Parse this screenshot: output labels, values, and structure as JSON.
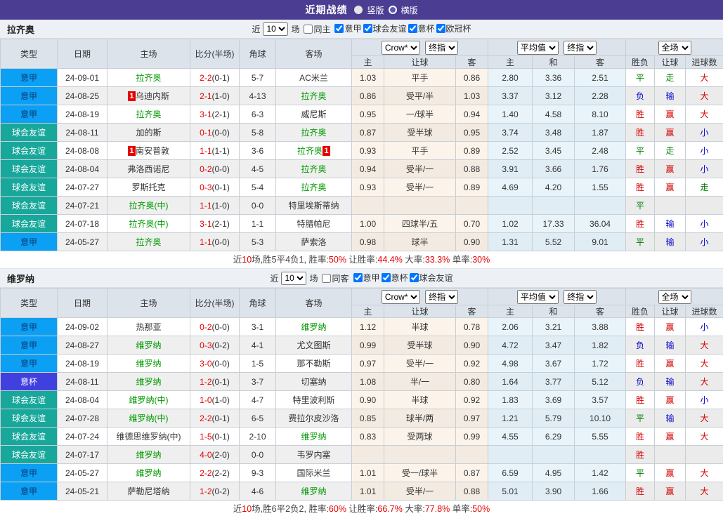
{
  "title_bar": {
    "title": "近期战绩",
    "radios": [
      {
        "label": "竖版",
        "selected": true
      },
      {
        "label": "横版",
        "selected": false
      }
    ]
  },
  "filter_labels": {
    "near": "近",
    "games": "场"
  },
  "table_header": {
    "type": "类型",
    "date": "日期",
    "home": "主场",
    "score": "比分(半场)",
    "corners": "角球",
    "away": "客场",
    "selects": {
      "book": "Crow*",
      "final_a": "终指",
      "avg": "平均值",
      "final_b": "终指",
      "scope": "全场"
    },
    "sub": [
      "主",
      "让球",
      "客",
      "主",
      "和",
      "客",
      "胜负",
      "让球",
      "进球数"
    ]
  },
  "colors": {
    "titlebar_purple": "#4B3D92",
    "seriea_blue": "#0BA0F3",
    "friendly_teal": "#18A79B",
    "cup_indigo": "#4040DF",
    "focus_team_green": "#009900",
    "score_red": "#E60000",
    "win_red": "#D40000",
    "draw_green": "#008000",
    "lose_blue": "#0000CC"
  },
  "sections": [
    {
      "team": "拉齐奥",
      "filter": {
        "count": "10",
        "same_label": "同主",
        "same_checked": false,
        "leagues": [
          {
            "label": "意甲",
            "checked": true
          },
          {
            "label": "球会友谊",
            "checked": true
          },
          {
            "label": "意杯",
            "checked": true
          },
          {
            "label": "欧冠杯",
            "checked": true
          }
        ]
      },
      "rows": [
        {
          "league": "意甲",
          "date": "24-09-01",
          "home": {
            "name": "拉齐奥",
            "focus": true
          },
          "score": {
            "full": "2-2",
            "half": "(0-1)"
          },
          "corners": "5-7",
          "away": {
            "name": "AC米兰"
          },
          "odds": [
            "1.03",
            "平手",
            "0.86"
          ],
          "avg": [
            "2.80",
            "3.36",
            "2.51"
          ],
          "results": [
            "平",
            "走",
            "大"
          ]
        },
        {
          "league": "意甲",
          "date": "24-08-25",
          "home": {
            "name": "乌迪内斯",
            "badge": "1",
            "badge_pos": "before"
          },
          "score": {
            "full": "2-1",
            "half": "(1-0)"
          },
          "corners": "4-13",
          "away": {
            "name": "拉齐奥",
            "focus": true
          },
          "odds": [
            "0.86",
            "受平/半",
            "1.03"
          ],
          "avg": [
            "3.37",
            "3.12",
            "2.28"
          ],
          "results": [
            "负",
            "输",
            "大"
          ]
        },
        {
          "league": "意甲",
          "date": "24-08-19",
          "home": {
            "name": "拉齐奥",
            "focus": true
          },
          "score": {
            "full": "3-1",
            "half": "(2-1)"
          },
          "corners": "6-3",
          "away": {
            "name": "威尼斯"
          },
          "odds": [
            "0.95",
            "一/球半",
            "0.94"
          ],
          "avg": [
            "1.40",
            "4.58",
            "8.10"
          ],
          "results": [
            "胜",
            "赢",
            "大"
          ]
        },
        {
          "league": "球会友谊",
          "date": "24-08-11",
          "home": {
            "name": "加的斯"
          },
          "score": {
            "full": "0-1",
            "half": "(0-0)"
          },
          "corners": "5-8",
          "away": {
            "name": "拉齐奥",
            "focus": true
          },
          "odds": [
            "0.87",
            "受半球",
            "0.95"
          ],
          "avg": [
            "3.74",
            "3.48",
            "1.87"
          ],
          "results": [
            "胜",
            "赢",
            "小"
          ]
        },
        {
          "league": "球会友谊",
          "date": "24-08-08",
          "home": {
            "name": "南安普敦",
            "badge": "1",
            "badge_pos": "before"
          },
          "score": {
            "full": "1-1",
            "half": "(1-1)"
          },
          "corners": "3-6",
          "away": {
            "name": "拉齐奥",
            "focus": true,
            "badge": "1",
            "badge_pos": "after"
          },
          "odds": [
            "0.93",
            "平手",
            "0.89"
          ],
          "avg": [
            "2.52",
            "3.45",
            "2.48"
          ],
          "results": [
            "平",
            "走",
            "小"
          ]
        },
        {
          "league": "球会友谊",
          "date": "24-08-04",
          "home": {
            "name": "弗洛西诺尼"
          },
          "score": {
            "full": "0-2",
            "half": "(0-0)"
          },
          "corners": "4-5",
          "away": {
            "name": "拉齐奥",
            "focus": true
          },
          "odds": [
            "0.94",
            "受半/一",
            "0.88"
          ],
          "avg": [
            "3.91",
            "3.66",
            "1.76"
          ],
          "results": [
            "胜",
            "赢",
            "小"
          ]
        },
        {
          "league": "球会友谊",
          "date": "24-07-27",
          "home": {
            "name": "罗斯托克"
          },
          "score": {
            "full": "0-3",
            "half": "(0-1)"
          },
          "corners": "5-4",
          "away": {
            "name": "拉齐奥",
            "focus": true
          },
          "odds": [
            "0.93",
            "受半/一",
            "0.89"
          ],
          "avg": [
            "4.69",
            "4.20",
            "1.55"
          ],
          "results": [
            "胜",
            "赢",
            "走"
          ]
        },
        {
          "league": "球会友谊",
          "date": "24-07-21",
          "home": {
            "name": "拉齐奥(中)",
            "focus": true
          },
          "score": {
            "full": "1-1",
            "half": "(1-0)"
          },
          "corners": "0-0",
          "away": {
            "name": "特里埃斯蒂纳"
          },
          "odds": [
            "",
            "",
            ""
          ],
          "avg": [
            "",
            "",
            ""
          ],
          "results": [
            "平",
            "",
            ""
          ]
        },
        {
          "league": "球会友谊",
          "date": "24-07-18",
          "home": {
            "name": "拉齐奥(中)",
            "focus": true
          },
          "score": {
            "full": "3-1",
            "half": "(2-1)"
          },
          "corners": "1-1",
          "away": {
            "name": "特腊帕尼"
          },
          "odds": [
            "1.00",
            "四球半/五",
            "0.70"
          ],
          "avg": [
            "1.02",
            "17.33",
            "36.04"
          ],
          "results": [
            "胜",
            "输",
            "小"
          ]
        },
        {
          "league": "意甲",
          "date": "24-05-27",
          "home": {
            "name": "拉齐奥",
            "focus": true
          },
          "score": {
            "full": "1-1",
            "half": "(0-0)"
          },
          "corners": "5-3",
          "away": {
            "name": "萨索洛"
          },
          "odds": [
            "0.98",
            "球半",
            "0.90"
          ],
          "avg": [
            "1.31",
            "5.52",
            "9.01"
          ],
          "results": [
            "平",
            "输",
            "小"
          ]
        }
      ],
      "summary": [
        {
          "text": "近"
        },
        {
          "text": "10",
          "red": true
        },
        {
          "text": "场,胜5平4负1, 胜率:"
        },
        {
          "text": "50%",
          "red": true
        },
        {
          "text": " 让胜率:"
        },
        {
          "text": "44.4%",
          "red": true
        },
        {
          "text": " 大率:"
        },
        {
          "text": "33.3%",
          "red": true
        },
        {
          "text": " 单率:"
        },
        {
          "text": "30%",
          "red": true
        }
      ]
    },
    {
      "team": "维罗纳",
      "filter": {
        "count": "10",
        "same_label": "同客",
        "same_checked": false,
        "leagues": [
          {
            "label": "意甲",
            "checked": true
          },
          {
            "label": "意杯",
            "checked": true
          },
          {
            "label": "球会友谊",
            "checked": true
          }
        ]
      },
      "rows": [
        {
          "league": "意甲",
          "date": "24-09-02",
          "home": {
            "name": "热那亚"
          },
          "score": {
            "full": "0-2",
            "half": "(0-0)"
          },
          "corners": "3-1",
          "away": {
            "name": "维罗纳",
            "focus": true
          },
          "odds": [
            "1.12",
            "半球",
            "0.78"
          ],
          "avg": [
            "2.06",
            "3.21",
            "3.88"
          ],
          "results": [
            "胜",
            "赢",
            "小"
          ]
        },
        {
          "league": "意甲",
          "date": "24-08-27",
          "home": {
            "name": "维罗纳",
            "focus": true
          },
          "score": {
            "full": "0-3",
            "half": "(0-2)"
          },
          "corners": "4-1",
          "away": {
            "name": "尤文图斯"
          },
          "odds": [
            "0.99",
            "受半球",
            "0.90"
          ],
          "avg": [
            "4.72",
            "3.47",
            "1.82"
          ],
          "results": [
            "负",
            "输",
            "大"
          ]
        },
        {
          "league": "意甲",
          "date": "24-08-19",
          "home": {
            "name": "维罗纳",
            "focus": true
          },
          "score": {
            "full": "3-0",
            "half": "(0-0)"
          },
          "corners": "1-5",
          "away": {
            "name": "那不勒斯"
          },
          "odds": [
            "0.97",
            "受半/一",
            "0.92"
          ],
          "avg": [
            "4.98",
            "3.67",
            "1.72"
          ],
          "results": [
            "胜",
            "赢",
            "大"
          ]
        },
        {
          "league": "意杯",
          "date": "24-08-11",
          "home": {
            "name": "维罗纳",
            "focus": true
          },
          "score": {
            "full": "1-2",
            "half": "(0-1)"
          },
          "corners": "3-7",
          "away": {
            "name": "切塞纳"
          },
          "odds": [
            "1.08",
            "半/一",
            "0.80"
          ],
          "avg": [
            "1.64",
            "3.77",
            "5.12"
          ],
          "results": [
            "负",
            "输",
            "大"
          ]
        },
        {
          "league": "球会友谊",
          "date": "24-08-04",
          "home": {
            "name": "维罗纳(中)",
            "focus": true
          },
          "score": {
            "full": "1-0",
            "half": "(1-0)"
          },
          "corners": "4-7",
          "away": {
            "name": "特里波利斯"
          },
          "odds": [
            "0.90",
            "半球",
            "0.92"
          ],
          "avg": [
            "1.83",
            "3.69",
            "3.57"
          ],
          "results": [
            "胜",
            "赢",
            "小"
          ]
        },
        {
          "league": "球会友谊",
          "date": "24-07-28",
          "home": {
            "name": "维罗纳(中)",
            "focus": true
          },
          "score": {
            "full": "2-2",
            "half": "(0-1)"
          },
          "corners": "6-5",
          "away": {
            "name": "费拉尔皮沙洛"
          },
          "odds": [
            "0.85",
            "球半/两",
            "0.97"
          ],
          "avg": [
            "1.21",
            "5.79",
            "10.10"
          ],
          "results": [
            "平",
            "输",
            "大"
          ]
        },
        {
          "league": "球会友谊",
          "date": "24-07-24",
          "home": {
            "name": "维德思维罗纳(中)"
          },
          "score": {
            "full": "1-5",
            "half": "(0-1)"
          },
          "corners": "2-10",
          "away": {
            "name": "维罗纳",
            "focus": true
          },
          "odds": [
            "0.83",
            "受两球",
            "0.99"
          ],
          "avg": [
            "4.55",
            "6.29",
            "5.55"
          ],
          "results": [
            "胜",
            "赢",
            "大"
          ]
        },
        {
          "league": "球会友谊",
          "date": "24-07-17",
          "home": {
            "name": "维罗纳",
            "focus": true
          },
          "score": {
            "full": "4-0",
            "half": "(2-0)"
          },
          "corners": "0-0",
          "away": {
            "name": "韦罗内塞"
          },
          "odds": [
            "",
            "",
            ""
          ],
          "avg": [
            "",
            "",
            ""
          ],
          "results": [
            "胜",
            "",
            ""
          ]
        },
        {
          "league": "意甲",
          "date": "24-05-27",
          "home": {
            "name": "维罗纳",
            "focus": true
          },
          "score": {
            "full": "2-2",
            "half": "(2-2)"
          },
          "corners": "9-3",
          "away": {
            "name": "国际米兰"
          },
          "odds": [
            "1.01",
            "受一/球半",
            "0.87"
          ],
          "avg": [
            "6.59",
            "4.95",
            "1.42"
          ],
          "results": [
            "平",
            "赢",
            "大"
          ]
        },
        {
          "league": "意甲",
          "date": "24-05-21",
          "home": {
            "name": "萨勒尼塔纳"
          },
          "score": {
            "full": "1-2",
            "half": "(0-2)"
          },
          "corners": "4-6",
          "away": {
            "name": "维罗纳",
            "focus": true
          },
          "odds": [
            "1.01",
            "受半/一",
            "0.88"
          ],
          "avg": [
            "5.01",
            "3.90",
            "1.66"
          ],
          "results": [
            "胜",
            "赢",
            "大"
          ]
        }
      ],
      "summary": [
        {
          "text": "近"
        },
        {
          "text": "10",
          "red": true
        },
        {
          "text": "场,胜6平2负2, 胜率:"
        },
        {
          "text": "60%",
          "red": true
        },
        {
          "text": " 让胜率:"
        },
        {
          "text": "66.7%",
          "red": true
        },
        {
          "text": " 大率:"
        },
        {
          "text": "77.8%",
          "red": true
        },
        {
          "text": " 单率:"
        },
        {
          "text": "50%",
          "red": true
        }
      ]
    }
  ]
}
